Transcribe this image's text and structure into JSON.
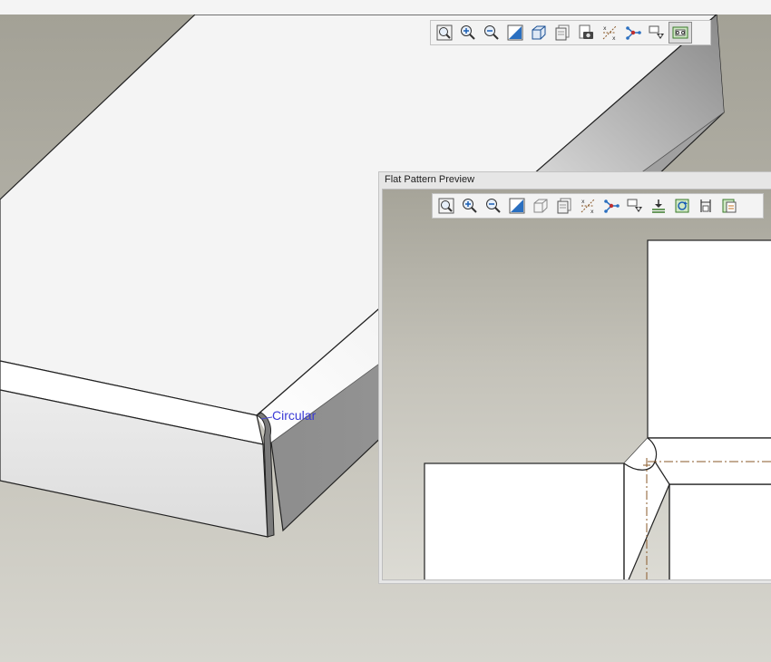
{
  "viewport": {
    "name": "3D model view"
  },
  "main_toolbar": {
    "buttons": [
      {
        "name": "zoom-to-fit",
        "icon": "zoom-fit-icon"
      },
      {
        "name": "zoom-in",
        "icon": "zoom-in-icon"
      },
      {
        "name": "zoom-out",
        "icon": "zoom-out-icon"
      },
      {
        "name": "reorient",
        "icon": "reorient-icon"
      },
      {
        "name": "display-style",
        "icon": "display-style-icon"
      },
      {
        "name": "saved-views",
        "icon": "saved-views-icon"
      },
      {
        "name": "capture-view",
        "icon": "camera-icon"
      },
      {
        "name": "datum-display",
        "icon": "datum-display-icon"
      },
      {
        "name": "spin-center",
        "icon": "spin-center-icon"
      },
      {
        "name": "annotation-display",
        "icon": "annotation-display-icon"
      },
      {
        "name": "flat-pattern-preview",
        "icon": "flat-pattern-icon",
        "active": true
      }
    ]
  },
  "annotation": {
    "circular_label": "Circular"
  },
  "flat_pattern_preview": {
    "title": "Flat Pattern Preview",
    "toolbar_buttons": [
      {
        "name": "zoom-to-fit",
        "icon": "zoom-fit-icon"
      },
      {
        "name": "zoom-in",
        "icon": "zoom-in-icon"
      },
      {
        "name": "zoom-out",
        "icon": "zoom-out-icon"
      },
      {
        "name": "reorient",
        "icon": "reorient-icon"
      },
      {
        "name": "display-style",
        "icon": "display-style-icon"
      },
      {
        "name": "saved-views",
        "icon": "saved-views-icon"
      },
      {
        "name": "datum-display",
        "icon": "datum-display-icon"
      },
      {
        "name": "spin-center",
        "icon": "spin-center-icon"
      },
      {
        "name": "annotation-display",
        "icon": "annotation-display-icon"
      },
      {
        "name": "align-flat",
        "icon": "align-flat-icon"
      },
      {
        "name": "refresh-preview",
        "icon": "refresh-icon"
      },
      {
        "name": "measure",
        "icon": "measure-icon"
      },
      {
        "name": "export-flat",
        "icon": "export-icon"
      }
    ]
  }
}
